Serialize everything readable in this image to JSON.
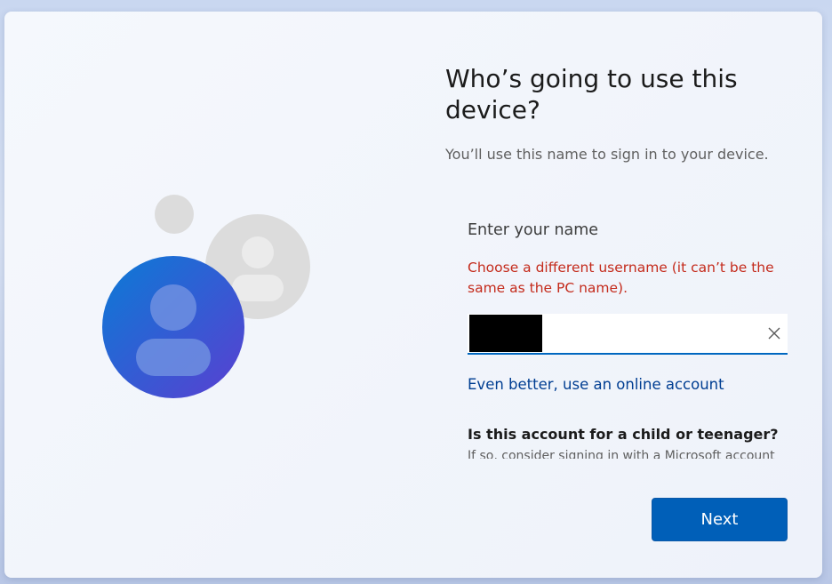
{
  "page": {
    "title": "Who’s going to use this device?",
    "subtitle": "You’ll use this name to sign in to your device."
  },
  "form": {
    "name_label": "Enter your name",
    "error_message": "Choose a different username (it can’t be the same as the PC name).",
    "name_value": "",
    "clear_icon": "close-icon",
    "online_account_link": "Even better, use an online account",
    "child_question": "Is this account for a child or teenager?",
    "child_detail": "If so, consider signing in with a Microsoft account"
  },
  "actions": {
    "next_label": "Next"
  },
  "colors": {
    "accent": "#005fb8",
    "error": "#c42b1c",
    "link": "#003e92",
    "avatar_blue_start": "#0a7bd6",
    "avatar_blue_end": "#5a3fd1"
  },
  "illustration": {
    "icon": "users-icon"
  }
}
